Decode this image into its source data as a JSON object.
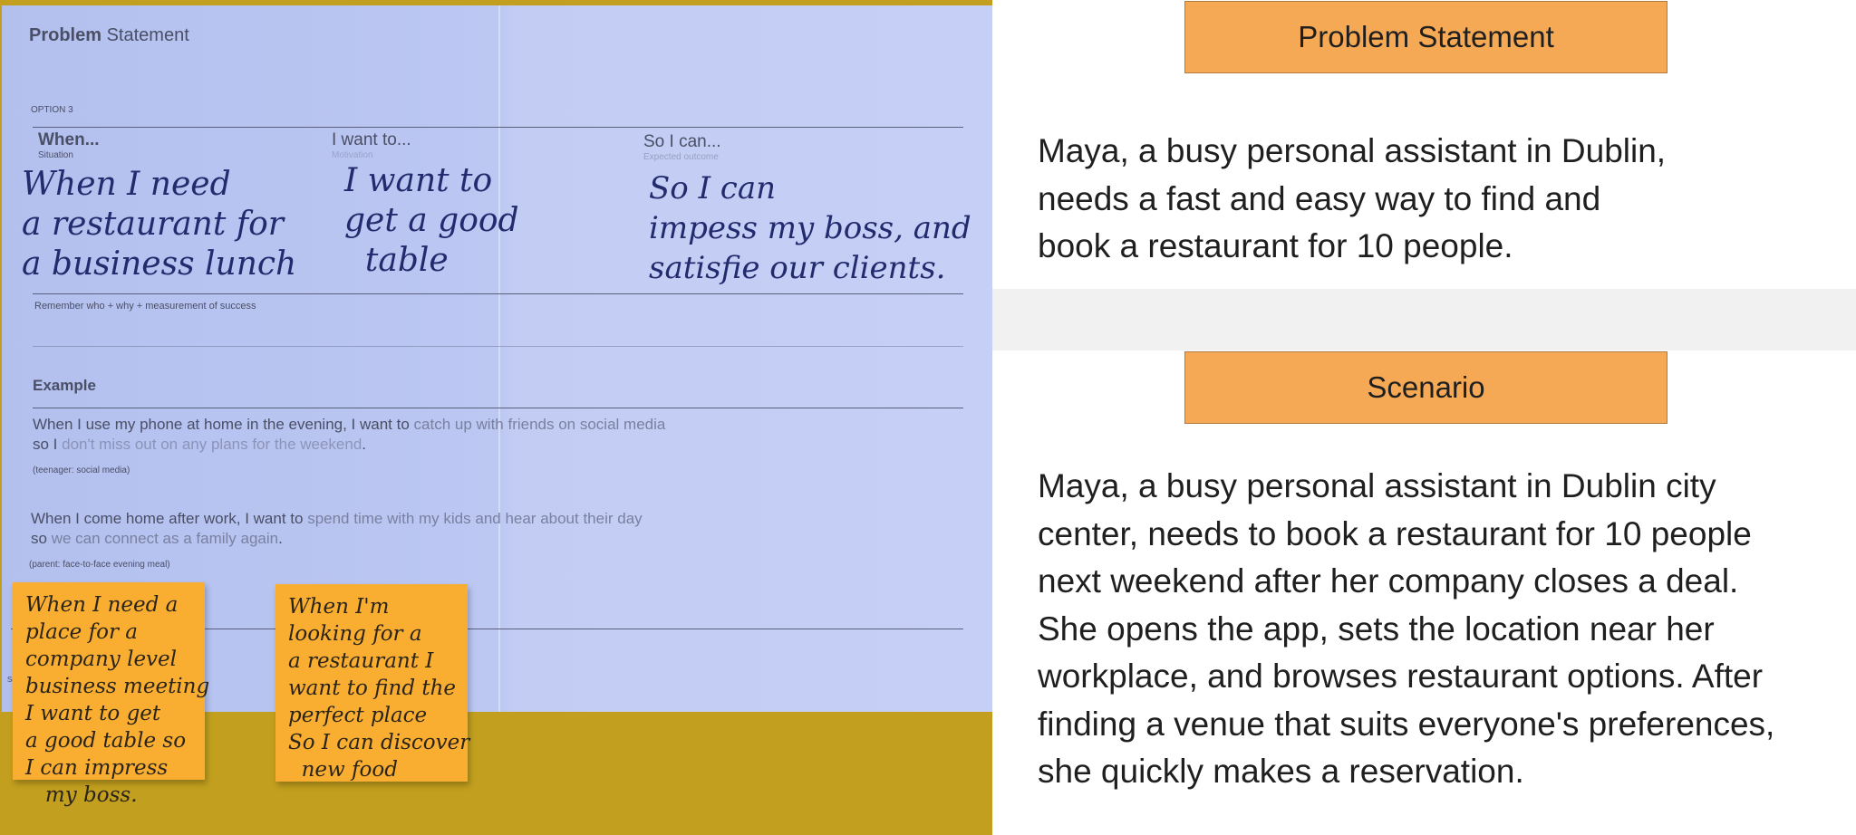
{
  "photo": {
    "title_bold": "Problem",
    "title_rest": " Statement",
    "option": "OPTION 3",
    "columns": [
      {
        "heading": "When...",
        "sub": "Situation",
        "handwritten": "When I need\na restaurant for\na business lunch"
      },
      {
        "heading": "I want to...",
        "sub": "Motivation",
        "handwritten": "I want to\nget a good\n  table"
      },
      {
        "heading": "So I can...",
        "sub": "Expected outcome",
        "handwritten": "So I can\nimpess my boss, and\nsatisfie our clients."
      }
    ],
    "reminder": "Remember who + why + measurement of success",
    "example_heading": "Example",
    "examples": [
      {
        "line1_a": "When I use my phone at home in the evening, I want to ",
        "line1_b": "catch up with friends on social media",
        "line2_a": "so I ",
        "line2_b": "don't miss out on any plans for the weekend",
        "line2_c": ".",
        "tag": "(teenager: social media)"
      },
      {
        "line1_a": "When I come home after work, I want to ",
        "line1_b": "spend time with my kids and hear about their day",
        "line2_a": "so ",
        "line2_b": "we can connect as a family again",
        "line2_c": ".",
        "tag": "(parent: face-to-face evening meal)"
      }
    ],
    "source_fragment": "Sou",
    "sticky_notes": [
      "When I need a\nplace for a\ncompany level\nbusiness meeting\nI want to get\na good table so\nI can impress\n   my boss.",
      "When I'm\nlooking for a\na restaurant I\nwant to find the\nperfect place\nSo I can discover\n  new food"
    ]
  },
  "panel": {
    "problem_button": "Problem Statement",
    "problem_text": "Maya, a busy personal assistant in Dublin,\nneeds a fast and easy way to find and\nbook a restaurant for 10 people.",
    "scenario_button": "Scenario",
    "scenario_text": "Maya, a busy personal assistant in Dublin city\ncenter, needs to book a restaurant for 10 people\nnext weekend after her company closes a deal.\nShe opens the app, sets the location near her\nworkplace, and browses restaurant options. After\nfinding a venue that suits everyone's preferences,\nshe quickly makes a reservation.",
    "accent": "#f6a955"
  }
}
